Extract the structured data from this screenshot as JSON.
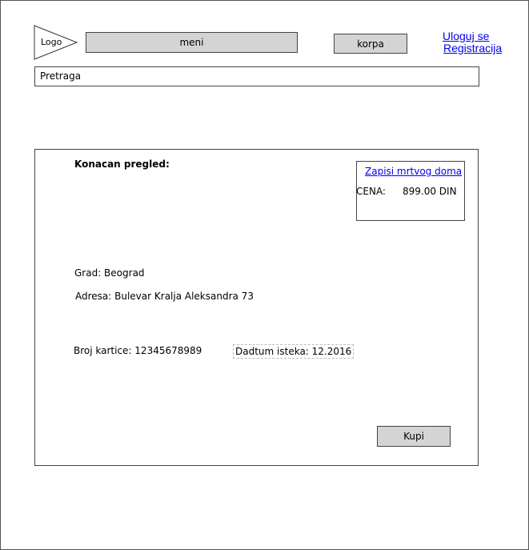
{
  "header": {
    "logo_label": "Logo",
    "menu_label": "meni",
    "cart_label": "korpa",
    "login_label": "Uloguj se",
    "register_label": "Registracija"
  },
  "search": {
    "placeholder": "Pretraga"
  },
  "review": {
    "title": "Konacan pregled:",
    "product": {
      "name": "Zapisi mrtvog doma",
      "price_label": "CENA:",
      "price_value": "899.00 DIN"
    },
    "city": "Grad: Beograd",
    "address": "Adresa: Bulevar Kralja Aleksandra 73",
    "card_number": "Broj kartice: 12345678989",
    "expiry": "Dadtum isteka: 12.2016",
    "buy_label": "Kupi"
  }
}
